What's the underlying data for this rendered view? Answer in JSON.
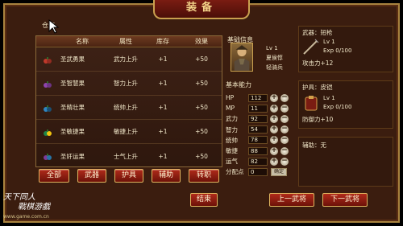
{
  "title": "装备",
  "left": {
    "tab_partial": "仓库",
    "columns": [
      "名称",
      "属性",
      "库存",
      "效果"
    ],
    "rows": [
      {
        "name": "圣武勇果",
        "attr": "武力上升",
        "stock": "+1",
        "effect": "+50",
        "color": "#c0392b"
      },
      {
        "name": "圣智慧果",
        "attr": "智力上升",
        "stock": "+1",
        "effect": "+50",
        "color": "#8e44ad"
      },
      {
        "name": "圣精壮果",
        "attr": "统帅上升",
        "stock": "+1",
        "effect": "+50",
        "color": "#2e86c1"
      },
      {
        "name": "圣敏捷果",
        "attr": "敏捷上升",
        "stock": "+1",
        "effect": "+50",
        "color": "#1e8449"
      },
      {
        "name": "圣奸运果",
        "attr": "士气上升",
        "stock": "+1",
        "effect": "+50",
        "color": "#7d3c98"
      }
    ]
  },
  "category_buttons": [
    "全部",
    "武器",
    "护具",
    "辅助",
    "转职"
  ],
  "basic": {
    "header": "基础信息",
    "level": "Lv 1",
    "name": "夏侯惇",
    "unit": "轻骑兵"
  },
  "stats": {
    "header": "基本能力",
    "rows": [
      {
        "label": "HP",
        "value": "112"
      },
      {
        "label": "MP",
        "value": "11"
      },
      {
        "label": "武力",
        "value": "92"
      },
      {
        "label": "智力",
        "value": "54"
      },
      {
        "label": "统帅",
        "value": "78"
      },
      {
        "label": "敏捷",
        "value": "88"
      },
      {
        "label": "运气",
        "value": "82"
      }
    ],
    "points_label": "分配点",
    "points_value": "0",
    "confirm_label": "确定"
  },
  "weapon": {
    "label": "武器：",
    "name": "短枪",
    "level": "Lv  1",
    "exp": "Exp 0/100",
    "effect": "攻击力+12"
  },
  "armor": {
    "label": "护具：",
    "name": "皮铠",
    "level": "Lv  1",
    "exp": "Exp 0/100",
    "effect": "防御力+10"
  },
  "aux": {
    "label": "辅助：",
    "value": "无"
  },
  "bottom_buttons": {
    "end": "结束",
    "prev": "上一武将",
    "next": "下一武将"
  },
  "watermark": {
    "line1": "天下同人",
    "line2": "戰棋游戲",
    "site": "www.game.com.cn"
  },
  "colors": {
    "accent": "#b02a1a",
    "gold": "#e0b55f"
  }
}
